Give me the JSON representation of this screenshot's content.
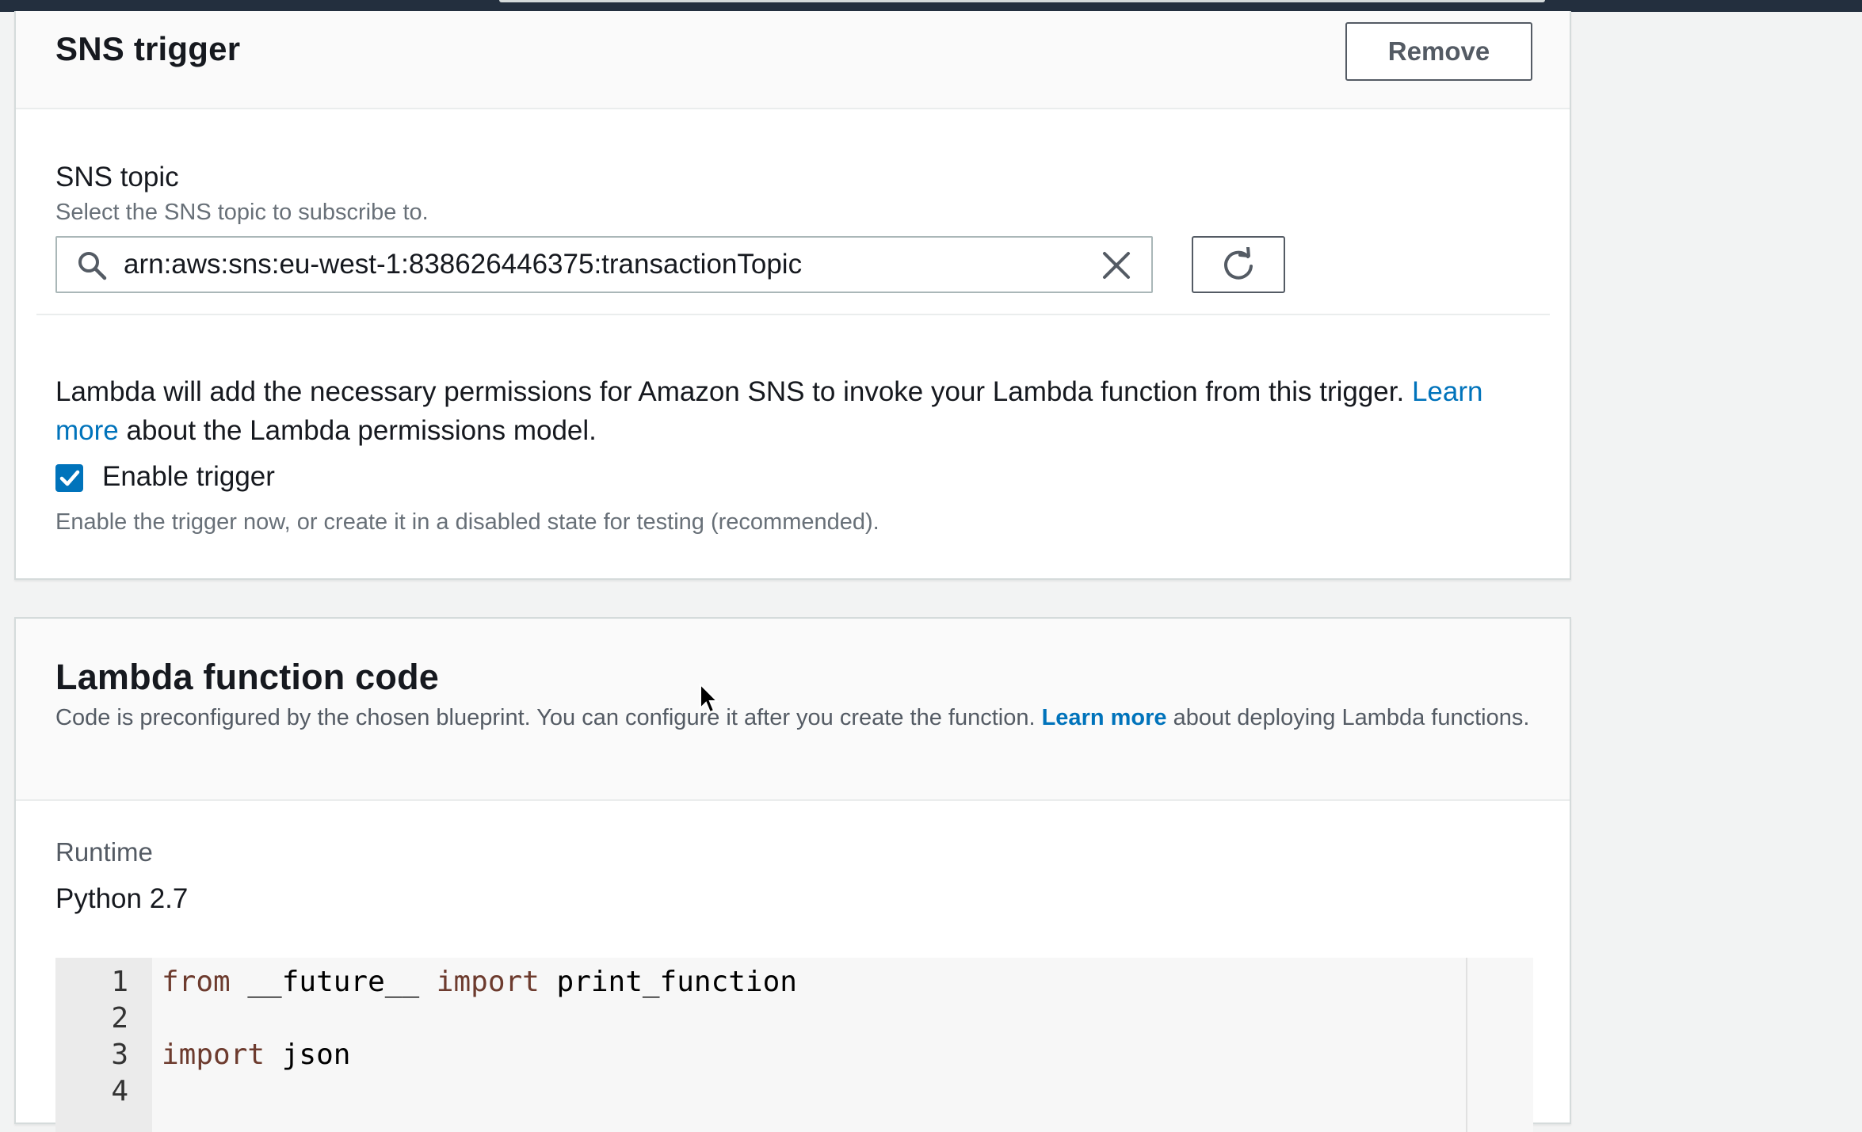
{
  "sns_trigger": {
    "title": "SNS trigger",
    "remove_label": "Remove",
    "topic_label": "SNS topic",
    "topic_description": "Select the SNS topic to subscribe to.",
    "topic_value": "arn:aws:sns:eu-west-1:838626446375:transactionTopic",
    "permissions_text_before": "Lambda will add the necessary permissions for Amazon SNS to invoke your Lambda function from this trigger.",
    "permissions_link": "Learn more",
    "permissions_text_after": "about the Lambda permissions model.",
    "enable_label": "Enable trigger",
    "enable_checked": true,
    "enable_description": "Enable the trigger now, or create it in a disabled state for testing (recommended)."
  },
  "lambda_code": {
    "title": "Lambda function code",
    "description_before": "Code is preconfigured by the chosen blueprint. You can configure it after you create the function.",
    "description_link": "Learn more",
    "description_after": "about deploying Lambda functions.",
    "runtime_label": "Runtime",
    "runtime_value": "Python 2.7",
    "code_lines": [
      {
        "number": "1",
        "parts": [
          [
            "kw",
            "from"
          ],
          [
            "",
            " __future__ "
          ],
          [
            "kw",
            "import"
          ],
          [
            "",
            " print_function"
          ]
        ]
      },
      {
        "number": "2",
        "parts": []
      },
      {
        "number": "3",
        "parts": [
          [
            "kw",
            "import"
          ],
          [
            "",
            " json"
          ]
        ]
      },
      {
        "number": "4",
        "parts": []
      }
    ]
  },
  "colors": {
    "link": "#0073bb",
    "checkbox": "#0073bb",
    "keyword": "#6d3b2e",
    "header_bg": "#232f3e"
  },
  "icons": [
    "search-icon",
    "clear-icon",
    "refresh-icon",
    "checkmark-icon",
    "mouse-cursor-icon"
  ]
}
